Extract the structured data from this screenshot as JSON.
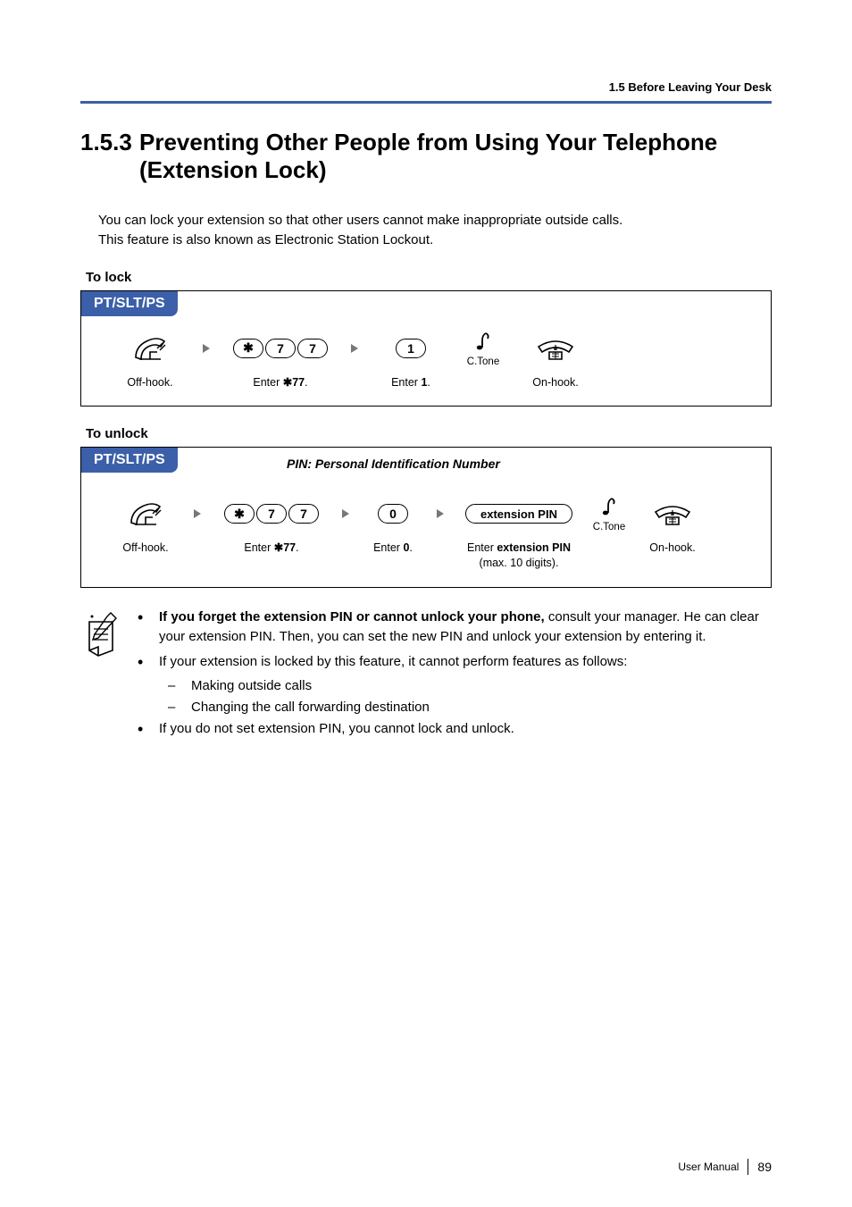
{
  "running_head": "1.5 Before Leaving Your Desk",
  "section": {
    "number": "1.5.3",
    "title": "Preventing Other People from Using Your Telephone (Extension Lock)"
  },
  "intro": {
    "line1": "You can lock your extension so that other users cannot make inappropriate outside calls.",
    "line2": "This feature is also known as Electronic Station Lockout."
  },
  "lock": {
    "heading": "To lock",
    "device_tab": "PT/SLT/PS",
    "steps": {
      "offhook": "Off-hook.",
      "enter77_pre": "Enter ",
      "enter77_code": "77",
      "enter77_post": ".",
      "key_star": "✱",
      "key_7a": "7",
      "key_7b": "7",
      "key_1": "1",
      "enter1_pre": "Enter ",
      "enter1_bold": "1",
      "enter1_post": ".",
      "ctone": "C.Tone",
      "onhook": "On-hook."
    }
  },
  "unlock": {
    "heading": "To unlock",
    "device_tab": "PT/SLT/PS",
    "pin_note": "PIN: Personal Identification Number",
    "steps": {
      "offhook": "Off-hook.",
      "enter77_pre": "Enter ",
      "enter77_code": "77",
      "enter77_post": ".",
      "key_star": "✱",
      "key_7a": "7",
      "key_7b": "7",
      "key_0": "0",
      "enter0_pre": "Enter ",
      "enter0_bold": "0",
      "enter0_post": ".",
      "ext_pin_key": "extension PIN",
      "ext_pin_caption_pre": "Enter ",
      "ext_pin_caption_bold": "extension PIN",
      "ext_pin_caption_post": " (max. 10 digits).",
      "ctone": "C.Tone",
      "onhook": "On-hook."
    }
  },
  "notes": {
    "b1_bold": "If you forget the extension PIN or cannot unlock your phone,",
    "b1_rest": " consult your manager. He can clear your extension PIN. Then, you can set the new PIN and unlock your extension by entering it.",
    "b2": "If your extension is locked by this feature, it cannot perform features as follows:",
    "b2_d1": "Making outside calls",
    "b2_d2": "Changing the call forwarding destination",
    "b3": "If you do not set extension PIN, you cannot lock and unlock."
  },
  "footer": {
    "label": "User Manual",
    "page": "89"
  }
}
